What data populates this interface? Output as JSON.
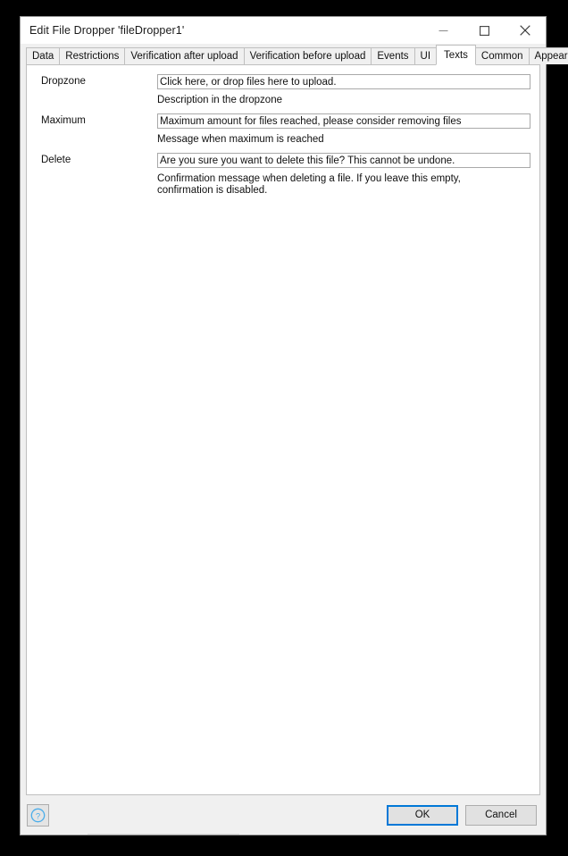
{
  "window": {
    "title": "Edit File Dropper 'fileDropper1'",
    "controls": {
      "minimize": "minimize-icon",
      "maximize": "maximize-icon",
      "close": "close-icon"
    }
  },
  "tabs": [
    {
      "label": "Data",
      "selected": false
    },
    {
      "label": "Restrictions",
      "selected": false
    },
    {
      "label": "Verification after upload",
      "selected": false
    },
    {
      "label": "Verification before upload",
      "selected": false
    },
    {
      "label": "Events",
      "selected": false
    },
    {
      "label": "UI",
      "selected": false
    },
    {
      "label": "Texts",
      "selected": true
    },
    {
      "label": "Common",
      "selected": false
    },
    {
      "label": "Appearance",
      "selected": false
    }
  ],
  "form": {
    "rows": [
      {
        "label": "Dropzone",
        "value": "Click here, or drop files here to upload.",
        "placeholder": "",
        "hint": "Description in the dropzone"
      },
      {
        "label": "Maximum",
        "value": "Maximum amount for files reached, please consider removing files",
        "placeholder": "",
        "hint": "Message when maximum is reached"
      },
      {
        "label": "Delete",
        "value": "Are you sure you want to delete this file? This cannot be undone.",
        "placeholder": "",
        "hint": "Confirmation message when deleting a file. If you leave this empty, confirmation is disabled."
      }
    ]
  },
  "footer": {
    "help_icon": "help-circle-icon",
    "ok_label": "OK",
    "cancel_label": "Cancel"
  },
  "colors": {
    "accent": "#0078d7",
    "help_icon": "#4aadea",
    "window_bg": "#f0f0f0",
    "panel_bg": "#ffffff",
    "border": "#bfbfbf"
  }
}
